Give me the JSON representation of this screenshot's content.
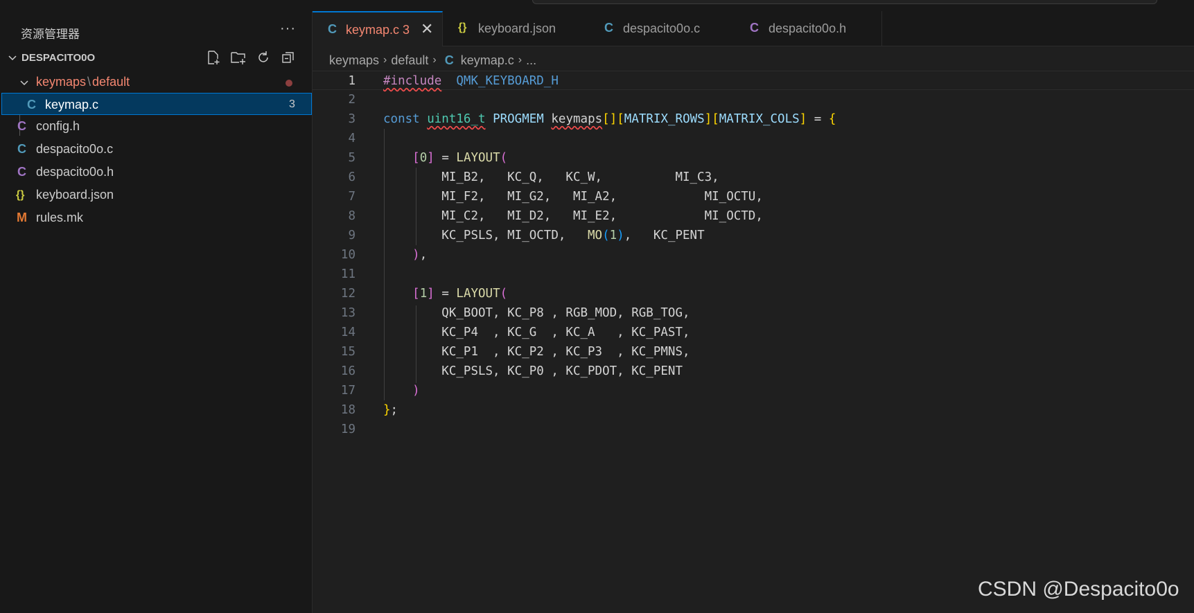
{
  "sidebar": {
    "title": "资源管理器",
    "more": "···",
    "project": "DESPACITO0O",
    "items": [
      {
        "icon": "C",
        "label": "keymap.c",
        "badge": "3"
      },
      {
        "icon": "C",
        "label": "config.h"
      },
      {
        "icon": "C",
        "label": "despacito0o.c"
      },
      {
        "icon": "C",
        "label": "despacito0o.h"
      },
      {
        "icon": "{}",
        "label": "keyboard.json"
      },
      {
        "icon": "M",
        "label": "rules.mk"
      }
    ],
    "folder": {
      "part1": "keymaps",
      "sep": "\\",
      "part2": "default"
    }
  },
  "tabs": [
    {
      "icon": "C",
      "label": "keymap.c 3"
    },
    {
      "icon": "{}",
      "label": "keyboard.json"
    },
    {
      "icon": "C",
      "label": "despacito0o.c"
    },
    {
      "icon": "C",
      "label": "despacito0o.h"
    }
  ],
  "breadcrumb": {
    "a": "keymaps",
    "b": "default",
    "icon": "C",
    "c": "keymap.c",
    "d": "..."
  },
  "code": {
    "l1": "#include",
    "l1b": "QMK_KEYBOARD_H",
    "l3_const": "const",
    "l3_type": "uint16_t",
    "l3_prog": "PROGMEM",
    "l3_var": "keymaps",
    "l3_rows": "MATRIX_ROWS",
    "l3_cols": "MATRIX_COLS",
    "l5_idx": "0",
    "l12_idx": "1",
    "layout": "LAYOUT",
    "l6": "MI_B2,   KC_Q,   KC_W,          MI_C3,",
    "l7": "MI_F2,   MI_G2,   MI_A2,            MI_OCTU,",
    "l8": "MI_C2,   MI_D2,   MI_E2,            MI_OCTD,",
    "l9a": "KC_PSLS, MI_OCTD,   ",
    "l9mo": "MO",
    "l9n": "1",
    "l9b": ",   KC_PENT",
    "l13": "QK_BOOT, KC_P8 , RGB_MOD, RGB_TOG,",
    "l14": "KC_P4  , KC_G  , KC_A   , KC_PAST,",
    "l15": "KC_P1  , KC_P2 , KC_P3  , KC_PMNS,",
    "l16": "KC_PSLS, KC_P0 , KC_PDOT, KC_PENT"
  },
  "line_numbers": [
    "1",
    "2",
    "3",
    "4",
    "5",
    "6",
    "7",
    "8",
    "9",
    "10",
    "11",
    "12",
    "13",
    "14",
    "15",
    "16",
    "17",
    "18",
    "19"
  ],
  "watermark": "CSDN @Despacito0o",
  "colors": {
    "accent": "#0078d4",
    "c_icon": "#519aba",
    "h_icon": "#a074c4",
    "json_icon": "#cbcb41",
    "mk_icon": "#e37933",
    "error": "#f48771"
  }
}
